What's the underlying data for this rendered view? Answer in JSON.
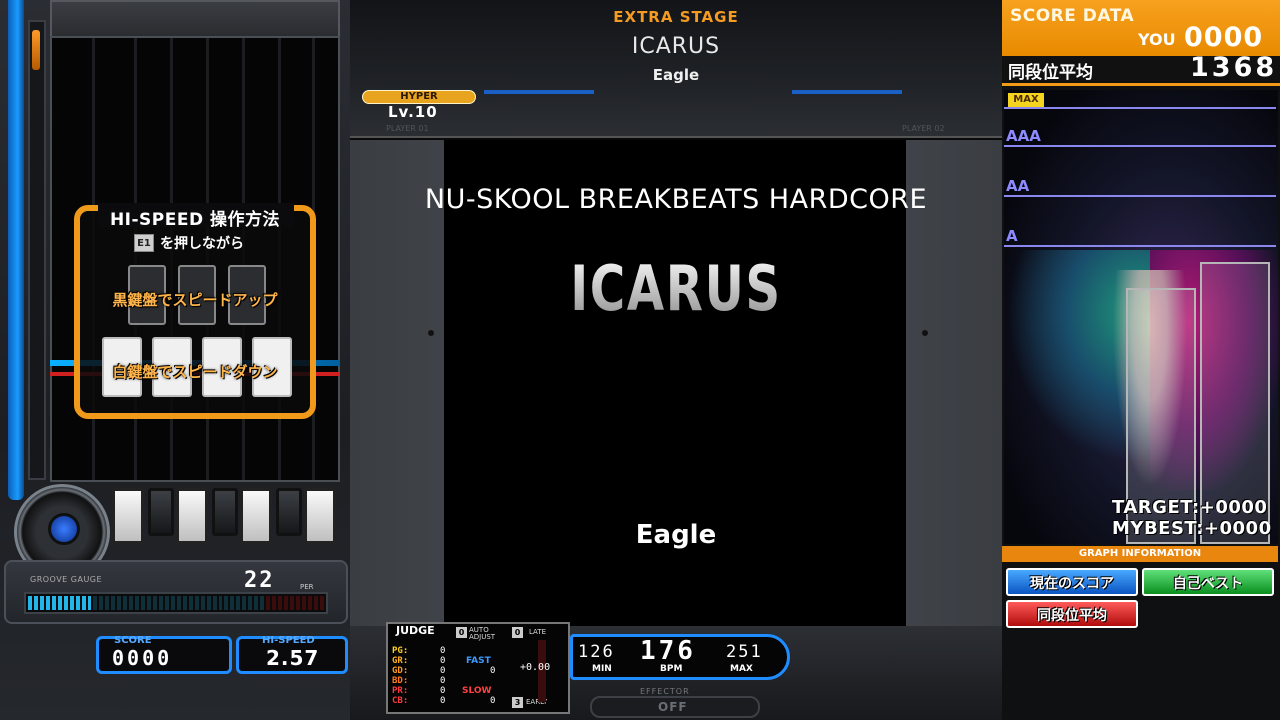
{
  "stage": {
    "label": "EXTRA STAGE"
  },
  "song": {
    "title": "ICARUS",
    "artist": "Eagle",
    "genre": "NU-SKOOL BREAKBEATS HARDCORE"
  },
  "difficulty": {
    "name": "HYPER",
    "level": "Lv.10",
    "color": "#e9a41f"
  },
  "players": {
    "p1": "PLAYER 01",
    "p2": "PLAYER 02"
  },
  "hispeed_help": {
    "title": "HI-SPEED 操作方法",
    "key": "E1",
    "hold_text": "を押しながら",
    "black_keys_text": "黒鍵盤でスピードアップ",
    "white_keys_text": "白鍵盤でスピードダウン"
  },
  "groove_gauge": {
    "label": "GROOVE GAUGE",
    "percent": "22",
    "unit": "PER",
    "value": 22,
    "color": "#22b7e8"
  },
  "score": {
    "label": "SCORE",
    "value": "0000"
  },
  "hi_speed": {
    "label": "HI-SPEED",
    "value": "2.57"
  },
  "judge": {
    "title": "JUDGE",
    "auto_adjust_key": "0",
    "auto_adjust_label": "AUTO ADJUST",
    "late_key": "0",
    "late_label": "LATE",
    "early_key": "3",
    "early_label": "EARLY",
    "rows": [
      {
        "label": "PG:",
        "value": "0",
        "color": "#ffd21f"
      },
      {
        "label": "GR:",
        "value": "0",
        "color": "#ffb21f"
      },
      {
        "label": "GD:",
        "value": "0",
        "color": "#ff9a1f"
      },
      {
        "label": "BD:",
        "value": "0",
        "color": "#ff7a1f"
      },
      {
        "label": "PR:",
        "value": "0",
        "color": "#ff3a3a"
      },
      {
        "label": "CB:",
        "value": "0",
        "color": "#ff3a3a"
      }
    ],
    "fast_label": "FAST",
    "fast_value": "0",
    "slow_label": "SLOW",
    "slow_value": "0",
    "timing": "+0.00"
  },
  "bpm": {
    "min": "126",
    "current": "176",
    "max": "251",
    "min_label": "MIN",
    "bpm_label": "BPM",
    "max_label": "MAX"
  },
  "effector": {
    "label": "EFFECTOR",
    "value": "OFF"
  },
  "score_data": {
    "title": "SCORE DATA",
    "you_label": "YOU",
    "you_score": "0000",
    "avg_label": "同段位平均",
    "avg_score": "1368",
    "grades": {
      "max": "MAX",
      "aaa": "AAA",
      "aa": "AA",
      "a": "A"
    },
    "target": "TARGET:+0000",
    "mybest": "MYBEST:+0000",
    "graph_info": "GRAPH INFORMATION",
    "buttons": {
      "current": "現在のスコア",
      "best": "自己ベスト",
      "avg": "同段位平均"
    }
  }
}
